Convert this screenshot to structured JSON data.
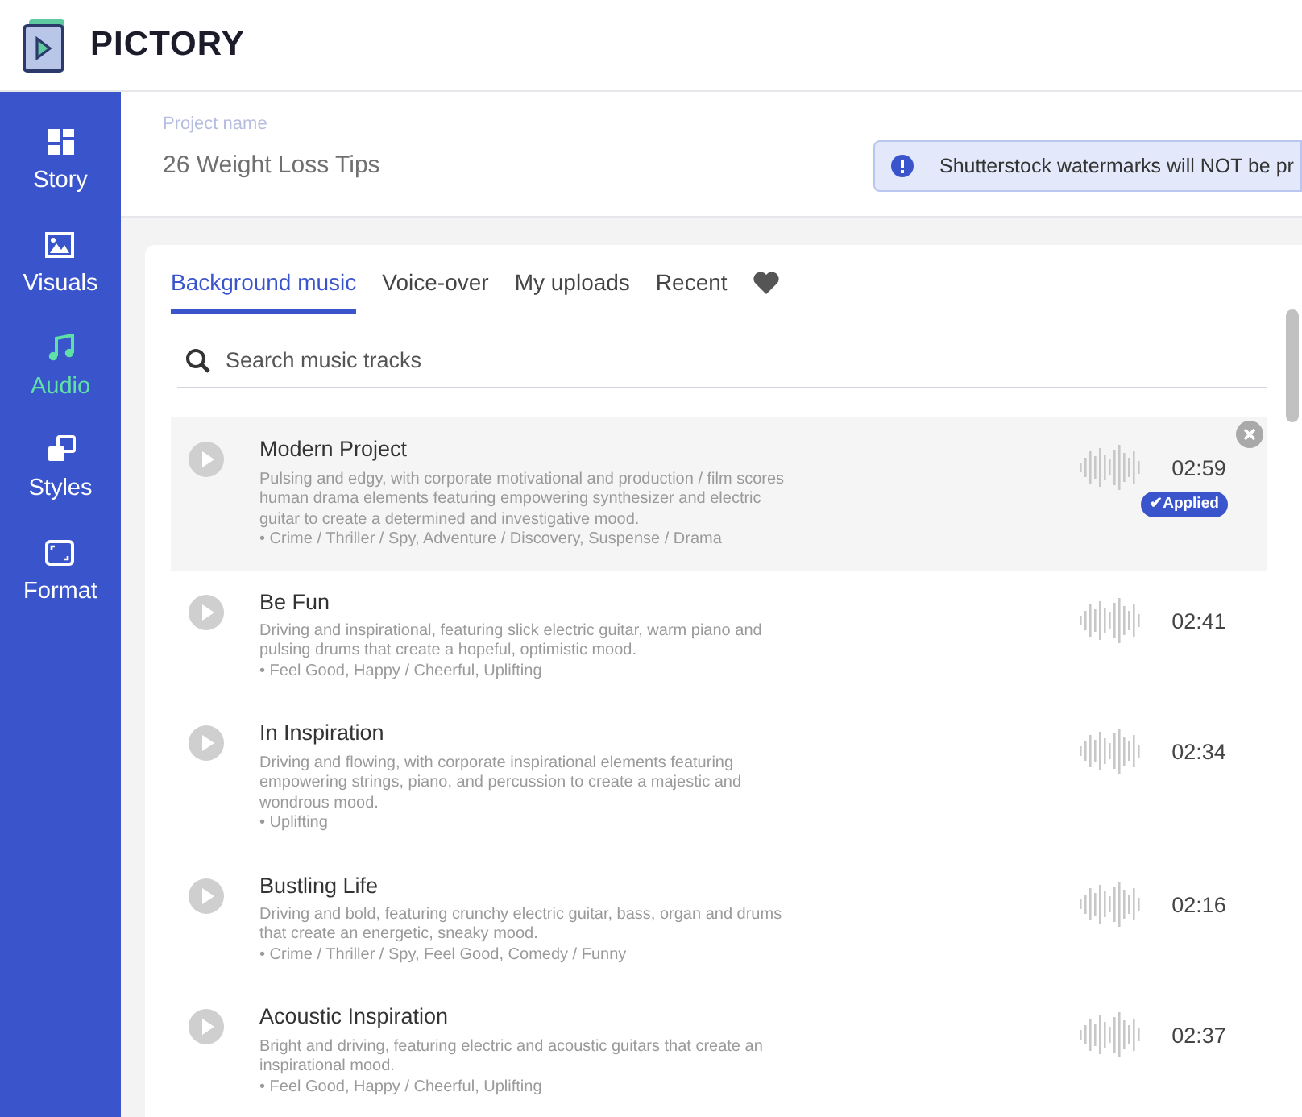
{
  "app": {
    "logo_text": "PICTORY"
  },
  "sidebar": {
    "items": [
      {
        "label": "Story",
        "selected": false
      },
      {
        "label": "Visuals",
        "selected": false
      },
      {
        "label": "Audio",
        "selected": true
      },
      {
        "label": "Styles",
        "selected": false
      },
      {
        "label": "Format",
        "selected": false
      }
    ]
  },
  "project": {
    "label": "Project name",
    "value": "26 Weight Loss Tips"
  },
  "notice": {
    "text": "Shutterstock watermarks will NOT be pr"
  },
  "tabs": [
    {
      "label": "Background music",
      "selected": true
    },
    {
      "label": "Voice-over",
      "selected": false
    },
    {
      "label": "My uploads",
      "selected": false
    },
    {
      "label": "Recent",
      "selected": false
    },
    {
      "kind": "favorites",
      "selected": false
    }
  ],
  "search": {
    "placeholder": "Search music tracks"
  },
  "tracks": [
    {
      "title": "Modern Project",
      "description": "Pulsing and edgy, with corporate motivational and production / film scores human drama elements featuring empowering synthesizer and electric guitar to create a determined and investigative mood.",
      "tags": "• Crime / Thriller / Spy, Adventure / Discovery, Suspense / Drama",
      "duration": "02:59",
      "applied": true,
      "badge": "✔Applied"
    },
    {
      "title": "Be Fun",
      "description": "Driving and inspirational, featuring slick electric guitar, warm piano and pulsing drums that create a hopeful, optimistic mood.",
      "tags": "• Feel Good, Happy / Cheerful, Uplifting",
      "duration": "02:41",
      "applied": false
    },
    {
      "title": "In Inspiration",
      "description": "Driving and flowing, with corporate inspirational elements featuring empowering strings, piano, and percussion to create a majestic and wondrous mood.",
      "tags": "• Uplifting",
      "duration": "02:34",
      "applied": false
    },
    {
      "title": "Bustling Life",
      "description": "Driving and bold, featuring crunchy electric guitar, bass, organ and drums that create an energetic, sneaky mood.",
      "tags": "• Crime / Thriller / Spy, Feel Good, Comedy / Funny",
      "duration": "02:16",
      "applied": false
    },
    {
      "title": "Acoustic Inspiration",
      "description": "Bright and driving, featuring electric and acoustic guitars that create an inspirational mood.",
      "tags": "• Feel Good, Happy / Cheerful, Uplifting",
      "duration": "02:37",
      "applied": false
    }
  ]
}
